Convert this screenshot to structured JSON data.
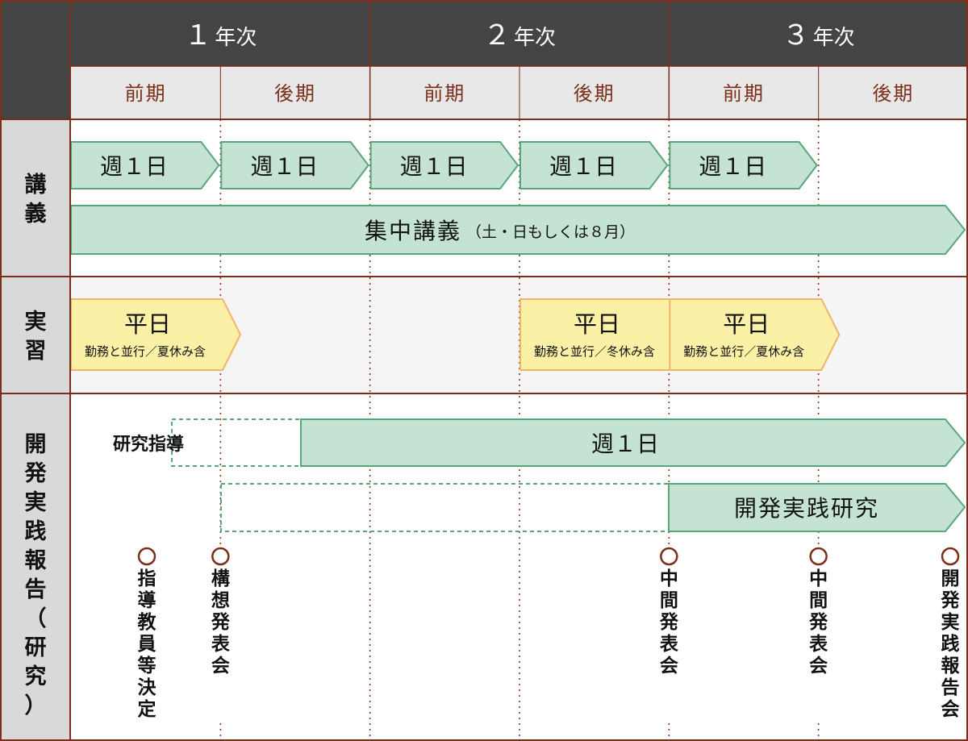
{
  "header": {
    "years": [
      {
        "number": "１",
        "suffix": "年次"
      },
      {
        "number": "２",
        "suffix": "年次"
      },
      {
        "number": "３",
        "suffix": "年次"
      }
    ],
    "terms": [
      "前期",
      "後期",
      "前期",
      "後期",
      "前期",
      "後期"
    ]
  },
  "rows": {
    "lecture": "講義",
    "practice": "実習",
    "research": "開発実践報告（研究）"
  },
  "lecture": {
    "weekly_label": "週１日",
    "weekly_count": 5,
    "intensive_label": "集中講義",
    "intensive_note": "（土・日もしくは８月）"
  },
  "practice": {
    "blocks": [
      {
        "title": "平日",
        "sub": "勤務と並行／夏休み含",
        "term": 0
      },
      {
        "title": "平日",
        "sub": "勤務と並行／冬休み含",
        "term": 3
      },
      {
        "title": "平日",
        "sub": "勤務と並行／夏休み含",
        "term": 4
      }
    ]
  },
  "research": {
    "guidance_label": "研究指導",
    "weekly_label": "週１日",
    "project_label": "開発実践研究"
  },
  "milestones": [
    {
      "label": "指導教員等決定",
      "position": 0.5
    },
    {
      "label": "構想発表会",
      "position": 1
    },
    {
      "label": "中間発表会",
      "position": 4
    },
    {
      "label": "中間発表会",
      "position": 5
    },
    {
      "label": "開発実践報告会",
      "position": 6
    }
  ],
  "colors": {
    "header_dark": "#444444",
    "term_bg": "#e8e8e8",
    "label_bg": "#d9d9d9",
    "border": "#7b2e1a",
    "green_fill": "#c5e3d3",
    "green_stroke": "#5aa67c",
    "yellow_fill": "#faf0a6",
    "yellow_stroke": "#f0b46a",
    "band_bg": "#f5f5f5"
  }
}
